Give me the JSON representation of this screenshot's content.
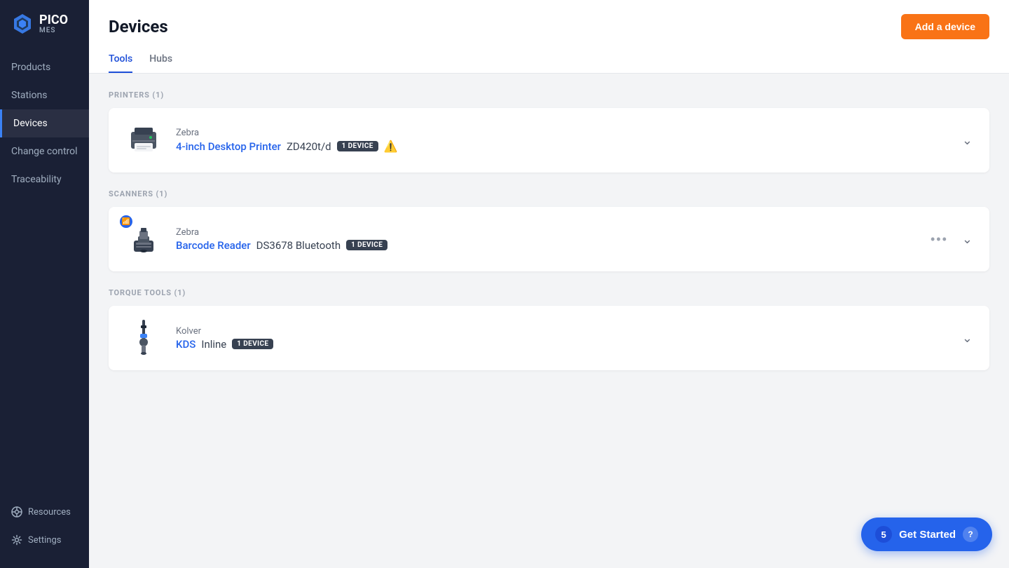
{
  "logo": {
    "text": "PICO",
    "sub": "MES"
  },
  "sidebar": {
    "items": [
      {
        "id": "products",
        "label": "Products",
        "active": false
      },
      {
        "id": "stations",
        "label": "Stations",
        "active": false
      },
      {
        "id": "devices",
        "label": "Devices",
        "active": true
      },
      {
        "id": "change-control",
        "label": "Change control",
        "active": false
      },
      {
        "id": "traceability",
        "label": "Traceability",
        "active": false
      }
    ],
    "bottom": [
      {
        "id": "resources",
        "label": "Resources"
      },
      {
        "id": "settings",
        "label": "Settings"
      }
    ]
  },
  "page": {
    "title": "Devices",
    "add_button": "Add a device"
  },
  "tabs": [
    {
      "id": "tools",
      "label": "Tools",
      "active": true
    },
    {
      "id": "hubs",
      "label": "Hubs",
      "active": false
    }
  ],
  "sections": [
    {
      "id": "printers",
      "header": "PRINTERS (1)",
      "devices": [
        {
          "brand": "Zebra",
          "name_link": "4-inch Desktop Printer",
          "model": "ZD420t/d",
          "badge": "1 DEVICE",
          "warning": true,
          "has_more": false
        }
      ]
    },
    {
      "id": "scanners",
      "header": "SCANNERS (1)",
      "devices": [
        {
          "brand": "Zebra",
          "name_link": "Barcode Reader",
          "model": "DS3678 Bluetooth",
          "badge": "1 DEVICE",
          "warning": false,
          "bluetooth": true,
          "has_more": true
        }
      ]
    },
    {
      "id": "torque-tools",
      "header": "TORQUE TOOLS (1)",
      "devices": [
        {
          "brand": "Kolver",
          "name_link": "KDS",
          "model": "Inline",
          "badge": "1 DEVICE",
          "warning": false,
          "has_more": false
        }
      ]
    }
  ],
  "get_started": {
    "count": "5",
    "label": "Get Started",
    "icon": "?"
  }
}
